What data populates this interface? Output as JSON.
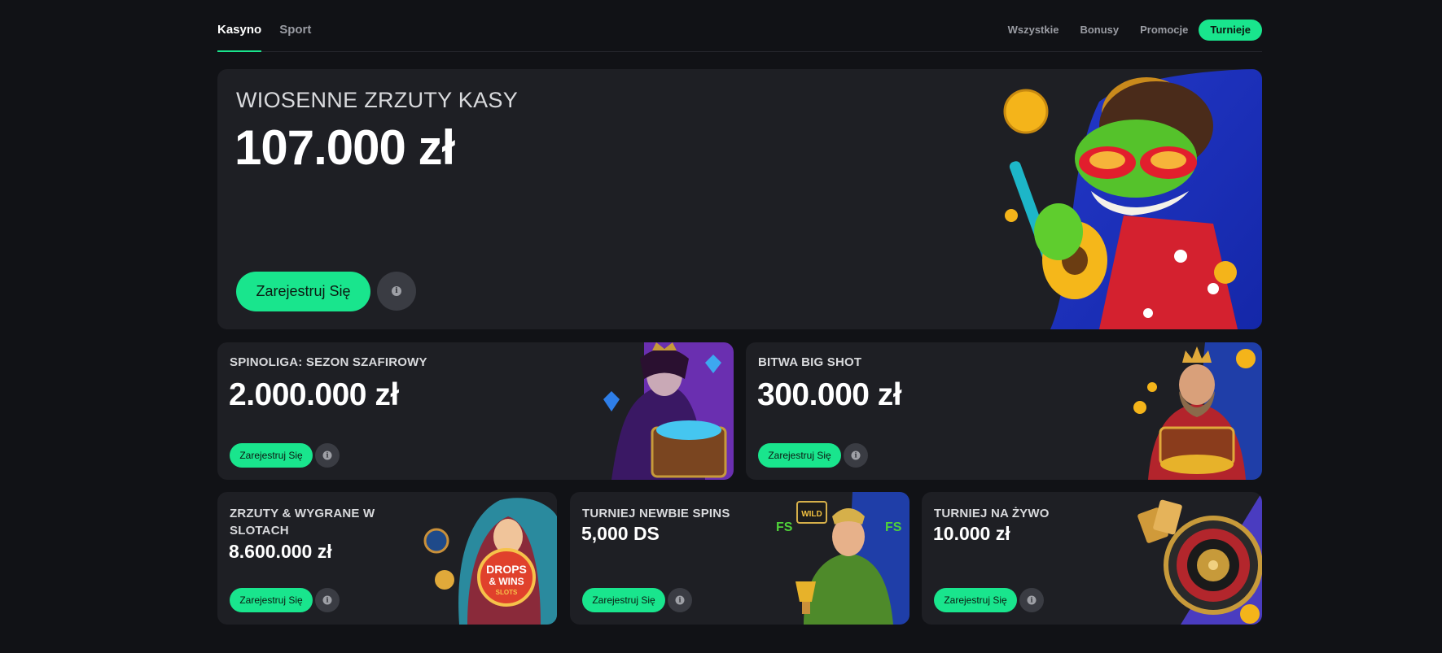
{
  "nav": {
    "tabs": [
      "Kasyno",
      "Sport"
    ],
    "filters": [
      "Wszystkie",
      "Bonusy",
      "Promocje",
      "Turnieje"
    ]
  },
  "hero": {
    "title": "WIOSENNE ZRZUTY KASY",
    "amount": "107.000 zł",
    "register_label": "Zarejestruj Się"
  },
  "cards": [
    {
      "title": "SPINOLIGA: SEZON SZAFIROWY",
      "amount": "2.000.000 zł",
      "register_label": "Zarejestruj Się"
    },
    {
      "title": "BITWA BIG SHOT",
      "amount": "300.000 zł",
      "register_label": "Zarejestruj Się"
    },
    {
      "title": "ZRZUTY & WYGRANE W SLOTACH",
      "amount": "8.600.000 zł",
      "register_label": "Zarejestruj Się",
      "art_text": [
        "DROPS",
        "& WINS",
        "SLOTS"
      ]
    },
    {
      "title": "TURNIEJ NEWBIE SPINS",
      "amount": "5,000 DS",
      "register_label": "Zarejestruj Się",
      "art_text": [
        "FS",
        "WILD"
      ]
    },
    {
      "title": "TURNIEJ NA ŻYWO",
      "amount": "10.000 zł",
      "register_label": "Zarejestruj Się"
    }
  ],
  "colors": {
    "accent": "#19e58d",
    "background": "#111216",
    "card": "#1e1f24"
  }
}
